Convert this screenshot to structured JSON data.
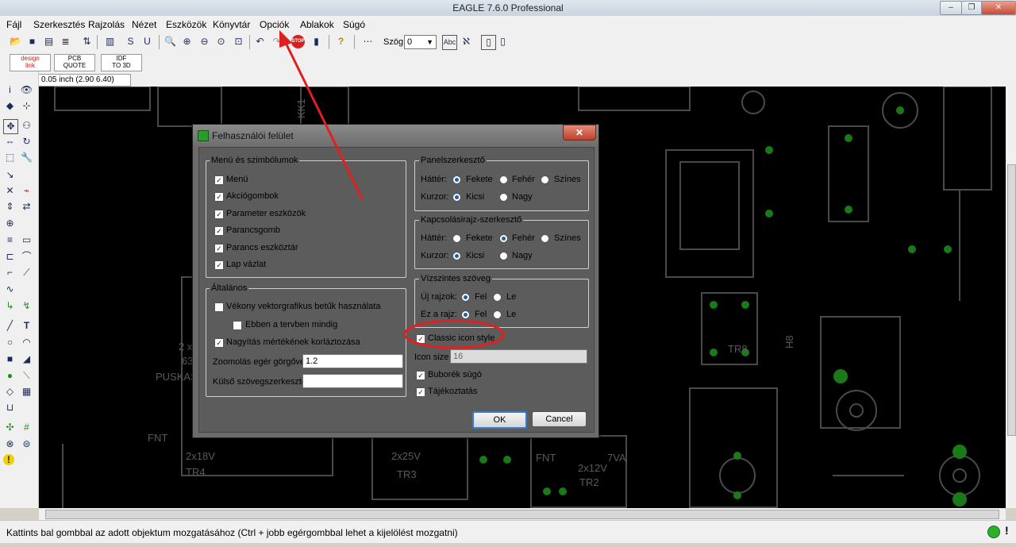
{
  "app": {
    "title": "EAGLE 7.6.0 Professional",
    "window_buttons": [
      "–",
      "❐",
      "✕"
    ]
  },
  "menubar": {
    "items": [
      "Fájl",
      "Szerkesztés",
      "Rajzolás",
      "Nézet",
      "Eszközök",
      "Könyvtár",
      "Opciók",
      "Ablakok",
      "Súgó"
    ]
  },
  "toolbar": {
    "angle_label": "Szög:",
    "angle_value": "0",
    "brand_buttons": [
      {
        "line1": "design",
        "line2": "link"
      },
      {
        "line1": "PCB",
        "line2": "QUOTE"
      },
      {
        "line1": "IDF",
        "line2": "TO 3D"
      }
    ]
  },
  "coordinates": "0.05 inch (2.90 6.40)",
  "canvas_labels": {
    "kk1": "KK1",
    "l1": "2 x",
    "l2": "63",
    "puskas": "PUSKAS",
    "fnt1": "FNT",
    "v18": "2x18V",
    "tr4": "TR4",
    "v25": "2x25V",
    "tr3": "TR3",
    "fnt2": "FNT",
    "v12": "2x12V",
    "tr2": "TR2",
    "va7": "7VA",
    "tr8": "TR8",
    "h8": "H8"
  },
  "status": {
    "text": "Kattints bal gombbal az adott objektum mozgatásához (Ctrl + jobb egérgombbal lehet a kijelölést mozgatni)"
  },
  "dialog": {
    "title": "Felhasználói felület",
    "close": "✕",
    "menus_group": {
      "label": "Menü és szimbólumok",
      "items": [
        {
          "label": "Menü",
          "checked": true
        },
        {
          "label": "Akciógombok",
          "checked": true
        },
        {
          "label": "Parameter eszközök",
          "checked": true
        },
        {
          "label": "Parancsgomb",
          "checked": true
        },
        {
          "label": "Parancs eszköztár",
          "checked": true
        },
        {
          "label": "Lap vázlat",
          "checked": true
        }
      ]
    },
    "general_group": {
      "label": "Általános",
      "vector_font": "Vékony vektorgrafikus betűk használata",
      "always_in_design": "Ebben a tervben mindig",
      "limit_zoom": "Nagyítás mértékének korláztozása",
      "mouse_zoom_label": "Zoomolás egér görgővel",
      "mouse_zoom_value": "1.2",
      "external_editor_label": "Külső szövegszerkesztő",
      "external_editor_value": ""
    },
    "layout_editor": {
      "label": "Panelszerkesztő",
      "bg_label": "Háttér:",
      "bg_options": [
        "Fekete",
        "Fehér",
        "Színes"
      ],
      "bg_selected": 0,
      "cursor_label": "Kurzor:",
      "cursor_options": [
        "Kicsi",
        "Nagy"
      ],
      "cursor_selected": 0
    },
    "schematic_editor": {
      "label": "Kapcsolásirajz-szerkesztő",
      "bg_label": "Háttér:",
      "bg_options": [
        "Fekete",
        "Fehér",
        "Színes"
      ],
      "bg_selected": 1,
      "cursor_label": "Kurzor:",
      "cursor_options": [
        "Kicsi",
        "Nagy"
      ],
      "cursor_selected": 0
    },
    "horizontal_text": {
      "label": "Vízszintes szöveg",
      "new_label": "Új rajzok:",
      "this_label": "Ez a rajz:",
      "options": [
        "Fel",
        "Le"
      ],
      "new_selected": 0,
      "this_selected": 0
    },
    "classic_icon_style": "Classic icon style",
    "icon_size_label": "Icon size",
    "icon_size_value": "16",
    "bubble_help": "Buborék súgó",
    "user_guidance": "Tájékoztatás",
    "ok": "OK",
    "cancel": "Cancel"
  },
  "colors": {
    "annotation": "#e02020",
    "canvas": "#000000",
    "dialog_bg": "#5c5c5c",
    "radio_dot": "#1e5fb4"
  }
}
